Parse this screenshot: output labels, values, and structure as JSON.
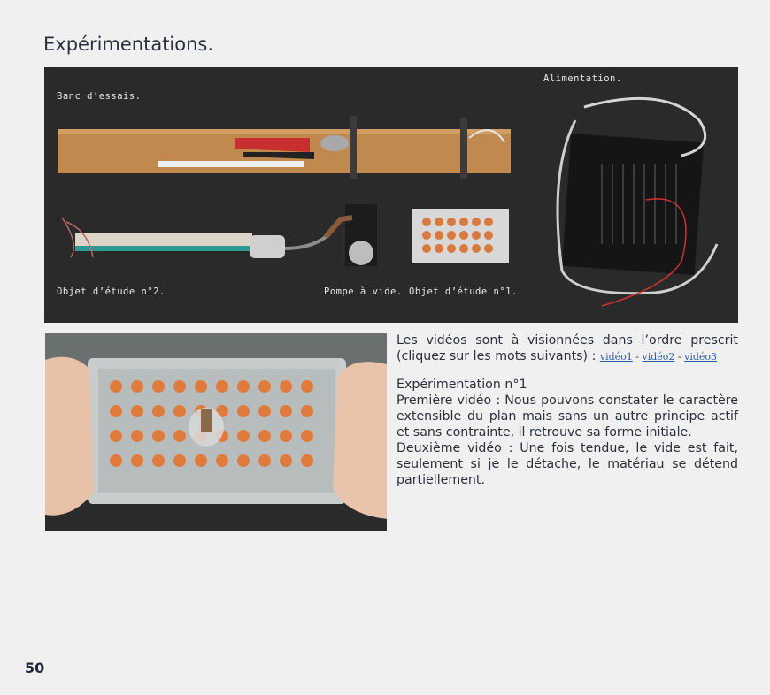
{
  "page": {
    "title": "Expérimentations.",
    "number": "50"
  },
  "top_photo": {
    "captions": {
      "banc": "Banc d’essais.",
      "alimentation": "Alimentation.",
      "objet2": "Objet d’étude n°2.",
      "pompe": "Pompe à vide.",
      "objet1": "Objet d’étude n°1."
    }
  },
  "text": {
    "intro": "Les vidéos sont à visionnées dans l’ordre prescrit (cliquez sur les mots suivants) :",
    "links": [
      "vidéo1",
      "vidéo2",
      "vidéo3"
    ],
    "separator": " - ",
    "exp_title": "Expérimentation n°1",
    "video1": "Première vidéo : Nous pouvons constater le caractère extensible du plan mais sans un autre principe actif et sans contrainte, il retrouve sa forme initiale.",
    "video2": "Deuxième vidéo :  Une fois tendue, le vide est fait, seulement si je le détache, le matériau se détend partiellement."
  },
  "colors": {
    "background": "#f0f0f0",
    "title": "#2a3040",
    "link": "#2a5db0",
    "photo_bg": "#2b2b2b"
  }
}
